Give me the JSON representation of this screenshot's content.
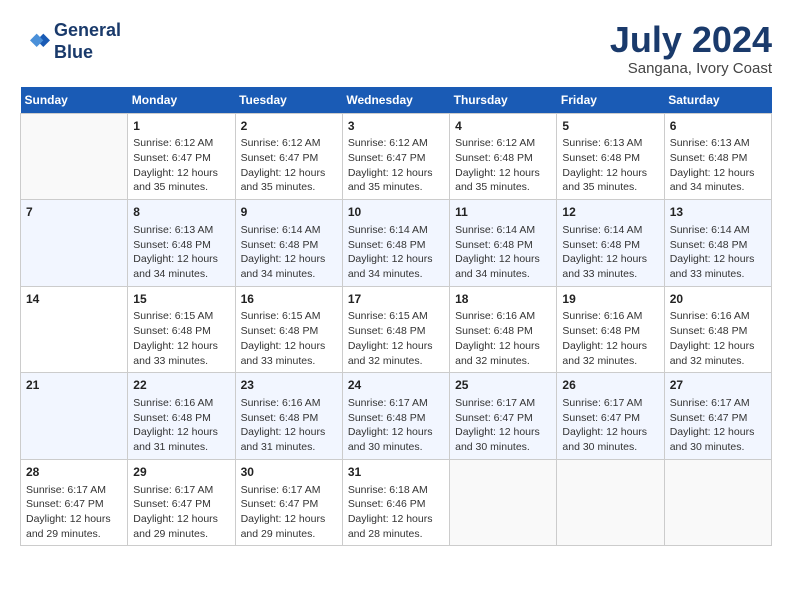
{
  "header": {
    "logo_line1": "General",
    "logo_line2": "Blue",
    "month_title": "July 2024",
    "location": "Sangana, Ivory Coast"
  },
  "days_of_week": [
    "Sunday",
    "Monday",
    "Tuesday",
    "Wednesday",
    "Thursday",
    "Friday",
    "Saturday"
  ],
  "weeks": [
    [
      {
        "day": "",
        "info": ""
      },
      {
        "day": "1",
        "info": "Sunrise: 6:12 AM\nSunset: 6:47 PM\nDaylight: 12 hours\nand 35 minutes."
      },
      {
        "day": "2",
        "info": "Sunrise: 6:12 AM\nSunset: 6:47 PM\nDaylight: 12 hours\nand 35 minutes."
      },
      {
        "day": "3",
        "info": "Sunrise: 6:12 AM\nSunset: 6:47 PM\nDaylight: 12 hours\nand 35 minutes."
      },
      {
        "day": "4",
        "info": "Sunrise: 6:12 AM\nSunset: 6:48 PM\nDaylight: 12 hours\nand 35 minutes."
      },
      {
        "day": "5",
        "info": "Sunrise: 6:13 AM\nSunset: 6:48 PM\nDaylight: 12 hours\nand 35 minutes."
      },
      {
        "day": "6",
        "info": "Sunrise: 6:13 AM\nSunset: 6:48 PM\nDaylight: 12 hours\nand 34 minutes."
      }
    ],
    [
      {
        "day": "7",
        "info": ""
      },
      {
        "day": "8",
        "info": "Sunrise: 6:13 AM\nSunset: 6:48 PM\nDaylight: 12 hours\nand 34 minutes."
      },
      {
        "day": "9",
        "info": "Sunrise: 6:14 AM\nSunset: 6:48 PM\nDaylight: 12 hours\nand 34 minutes."
      },
      {
        "day": "10",
        "info": "Sunrise: 6:14 AM\nSunset: 6:48 PM\nDaylight: 12 hours\nand 34 minutes."
      },
      {
        "day": "11",
        "info": "Sunrise: 6:14 AM\nSunset: 6:48 PM\nDaylight: 12 hours\nand 34 minutes."
      },
      {
        "day": "12",
        "info": "Sunrise: 6:14 AM\nSunset: 6:48 PM\nDaylight: 12 hours\nand 33 minutes."
      },
      {
        "day": "13",
        "info": "Sunrise: 6:14 AM\nSunset: 6:48 PM\nDaylight: 12 hours\nand 33 minutes."
      }
    ],
    [
      {
        "day": "14",
        "info": ""
      },
      {
        "day": "15",
        "info": "Sunrise: 6:15 AM\nSunset: 6:48 PM\nDaylight: 12 hours\nand 33 minutes."
      },
      {
        "day": "16",
        "info": "Sunrise: 6:15 AM\nSunset: 6:48 PM\nDaylight: 12 hours\nand 33 minutes."
      },
      {
        "day": "17",
        "info": "Sunrise: 6:15 AM\nSunset: 6:48 PM\nDaylight: 12 hours\nand 32 minutes."
      },
      {
        "day": "18",
        "info": "Sunrise: 6:16 AM\nSunset: 6:48 PM\nDaylight: 12 hours\nand 32 minutes."
      },
      {
        "day": "19",
        "info": "Sunrise: 6:16 AM\nSunset: 6:48 PM\nDaylight: 12 hours\nand 32 minutes."
      },
      {
        "day": "20",
        "info": "Sunrise: 6:16 AM\nSunset: 6:48 PM\nDaylight: 12 hours\nand 32 minutes."
      }
    ],
    [
      {
        "day": "21",
        "info": ""
      },
      {
        "day": "22",
        "info": "Sunrise: 6:16 AM\nSunset: 6:48 PM\nDaylight: 12 hours\nand 31 minutes."
      },
      {
        "day": "23",
        "info": "Sunrise: 6:16 AM\nSunset: 6:48 PM\nDaylight: 12 hours\nand 31 minutes."
      },
      {
        "day": "24",
        "info": "Sunrise: 6:17 AM\nSunset: 6:48 PM\nDaylight: 12 hours\nand 30 minutes."
      },
      {
        "day": "25",
        "info": "Sunrise: 6:17 AM\nSunset: 6:47 PM\nDaylight: 12 hours\nand 30 minutes."
      },
      {
        "day": "26",
        "info": "Sunrise: 6:17 AM\nSunset: 6:47 PM\nDaylight: 12 hours\nand 30 minutes."
      },
      {
        "day": "27",
        "info": "Sunrise: 6:17 AM\nSunset: 6:47 PM\nDaylight: 12 hours\nand 30 minutes."
      }
    ],
    [
      {
        "day": "28",
        "info": "Sunrise: 6:17 AM\nSunset: 6:47 PM\nDaylight: 12 hours\nand 29 minutes."
      },
      {
        "day": "29",
        "info": "Sunrise: 6:17 AM\nSunset: 6:47 PM\nDaylight: 12 hours\nand 29 minutes."
      },
      {
        "day": "30",
        "info": "Sunrise: 6:17 AM\nSunset: 6:47 PM\nDaylight: 12 hours\nand 29 minutes."
      },
      {
        "day": "31",
        "info": "Sunrise: 6:18 AM\nSunset: 6:46 PM\nDaylight: 12 hours\nand 28 minutes."
      },
      {
        "day": "",
        "info": ""
      },
      {
        "day": "",
        "info": ""
      },
      {
        "day": "",
        "info": ""
      }
    ]
  ]
}
